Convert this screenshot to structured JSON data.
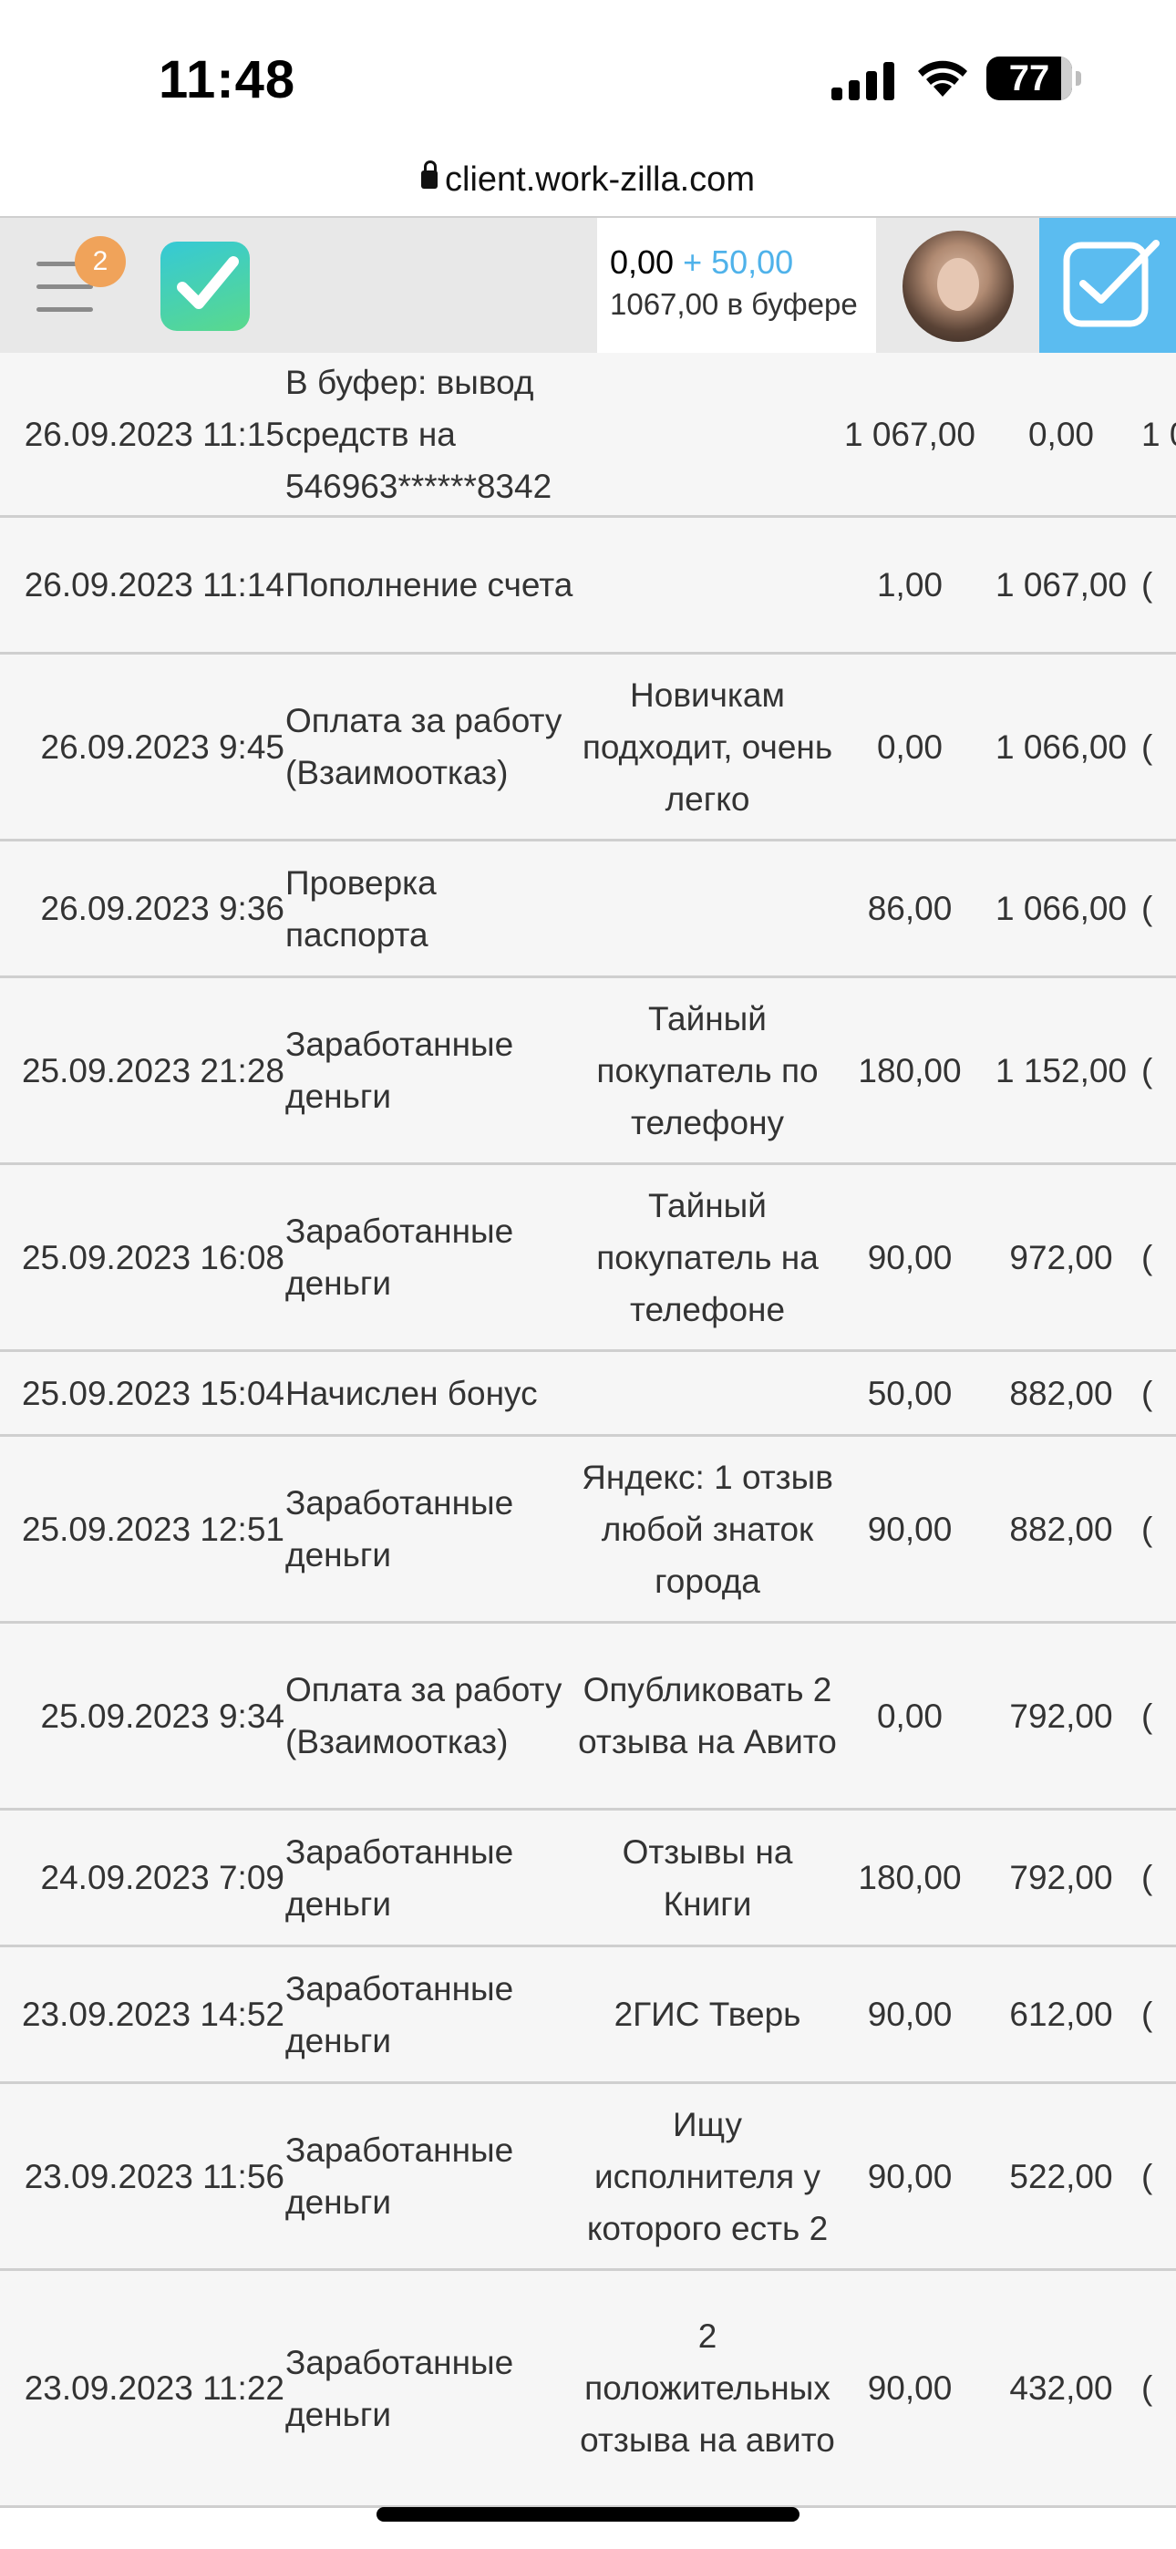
{
  "status_bar": {
    "time": "11:48",
    "battery": "77",
    "icons": [
      "signal-icon",
      "wifi-icon",
      "battery-icon"
    ]
  },
  "browser": {
    "url": "client.work-zilla.com"
  },
  "header": {
    "menu_badge": "2",
    "balance": "0,00",
    "bonus": "+ 50,00",
    "buffer": "1067,00 в буфере",
    "icons": [
      "menu-icon",
      "logo-check-icon",
      "tasks-check-icon"
    ]
  },
  "transactions": [
    {
      "date": "26.09.2023 11:15",
      "type": "В буфер: вывод средств на 546963******8342",
      "desc": "",
      "sum": "1 067,00",
      "balance": "0,00",
      "more": "1 0"
    },
    {
      "date": "26.09.2023 11:14",
      "type": "Пополнение счета",
      "desc": "",
      "sum": "1,00",
      "balance": "1 067,00",
      "more": "("
    },
    {
      "date": "26.09.2023 9:45",
      "type": "Оплата за работу (Взаимоотказ)",
      "desc": "Новичкам подходит, очень легко",
      "sum": "0,00",
      "balance": "1 066,00",
      "more": "("
    },
    {
      "date": "26.09.2023 9:36",
      "type": "Проверка паспорта",
      "desc": "",
      "sum": "86,00",
      "balance": "1 066,00",
      "more": "("
    },
    {
      "date": "25.09.2023 21:28",
      "type": "Заработанные деньги",
      "desc": "Тайный покупатель по телефону",
      "sum": "180,00",
      "balance": "1 152,00",
      "more": "("
    },
    {
      "date": "25.09.2023 16:08",
      "type": "Заработанные деньги",
      "desc": "Тайный покупатель на телефоне",
      "sum": "90,00",
      "balance": "972,00",
      "more": "("
    },
    {
      "date": "25.09.2023 15:04",
      "type": "Начислен бонус",
      "desc": "",
      "sum": "50,00",
      "balance": "882,00",
      "more": "("
    },
    {
      "date": "25.09.2023 12:51",
      "type": "Заработанные деньги",
      "desc": "Яндекс: 1 отзыв любой знаток города",
      "sum": "90,00",
      "balance": "882,00",
      "more": "("
    },
    {
      "date": "25.09.2023 9:34",
      "type": "Оплата за работу (Взаимоотказ)",
      "desc": "Опубликовать 2 отзыва на Авито",
      "sum": "0,00",
      "balance": "792,00",
      "more": "("
    },
    {
      "date": "24.09.2023 7:09",
      "type": "Заработанные деньги",
      "desc": "Отзывы на Книги",
      "sum": "180,00",
      "balance": "792,00",
      "more": "("
    },
    {
      "date": "23.09.2023 14:52",
      "type": "Заработанные деньги",
      "desc": "2ГИС Тверь",
      "sum": "90,00",
      "balance": "612,00",
      "more": "("
    },
    {
      "date": "23.09.2023 11:56",
      "type": "Заработанные деньги",
      "desc": "Ищу исполнителя у которого есть 2",
      "sum": "90,00",
      "balance": "522,00",
      "more": "("
    },
    {
      "date": "23.09.2023 11:22",
      "type": "Заработанные деньги",
      "desc": "2 положительных отзыва на авито",
      "sum": "90,00",
      "balance": "432,00",
      "more": "("
    }
  ]
}
